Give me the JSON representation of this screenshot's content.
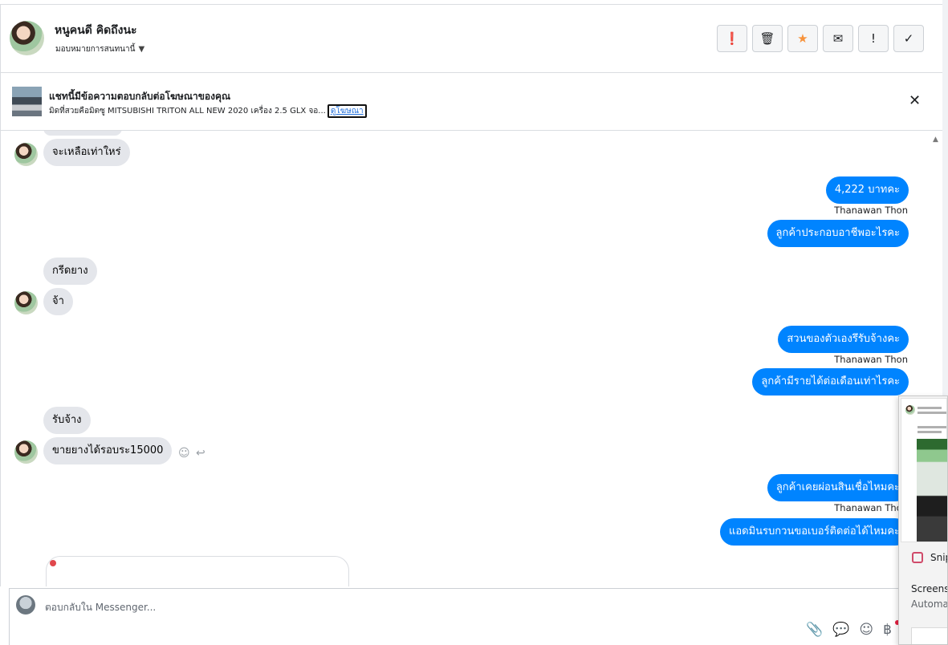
{
  "header": {
    "contact_name": "หนูคนดี คิดถึงนะ",
    "assign_label": "มอบหมายการสนทนานี้",
    "actions": [
      {
        "icon": "alert-circle-icon",
        "glyph": "❗"
      },
      {
        "icon": "trash-icon",
        "glyph": "🗑"
      },
      {
        "icon": "star-icon",
        "glyph": "★"
      },
      {
        "icon": "envelope-icon",
        "glyph": "✉"
      },
      {
        "icon": "exclamation-icon",
        "glyph": "!"
      },
      {
        "icon": "check-icon",
        "glyph": "✓"
      }
    ]
  },
  "banner": {
    "title": "แชทนี้มีข้อความตอบกลับต่อโฆษณาของคุณ",
    "subtitle": "มิดที่สวยคือมิตซู MITSUBISHI TRITON ALL NEW 2020 เครื่อง 2.5 GLX จอ...",
    "link_label": "ดูโฆษณา",
    "close_glyph": "✕"
  },
  "messages": [
    {
      "text": "จะเหลือเท่าใหร่"
    },
    {
      "text": "4,222 บาทคะ"
    },
    {
      "sender": "Thanawan Thon"
    },
    {
      "text": "ลูกค้าประกอบอาชีพอะไรคะ"
    },
    {
      "text": "กรีดยาง"
    },
    {
      "text": "จ้า"
    },
    {
      "text": "สวนของตัวเองรึรับจ้างคะ"
    },
    {
      "sender": "Thanawan Thon"
    },
    {
      "text": "ลูกค้ามีรายได้ต่อเดือนเท่าไรคะ"
    },
    {
      "text": "รับจ้าง"
    },
    {
      "text": "ขายยางได้รอบระ15000"
    },
    {
      "text": "ลูกค้าเคยผ่อนสินเชื่อไหมคะ"
    },
    {
      "sender": "Thanawan Thon"
    },
    {
      "text": "แอดมินรบกวนขอเบอร์ติดต่อได้ไหมคะ"
    }
  ],
  "composer": {
    "placeholder": "ตอบกลับใน Messenger...",
    "tools": [
      {
        "icon": "paperclip-icon",
        "glyph": "📎"
      },
      {
        "icon": "speech-bubble-icon",
        "glyph": "💬"
      },
      {
        "icon": "emoji-icon",
        "glyph": "☺"
      },
      {
        "icon": "baht-icon",
        "glyph": "฿"
      }
    ]
  },
  "overlay": {
    "app_name": "Snip",
    "title": "Screens",
    "description": "Automa"
  }
}
